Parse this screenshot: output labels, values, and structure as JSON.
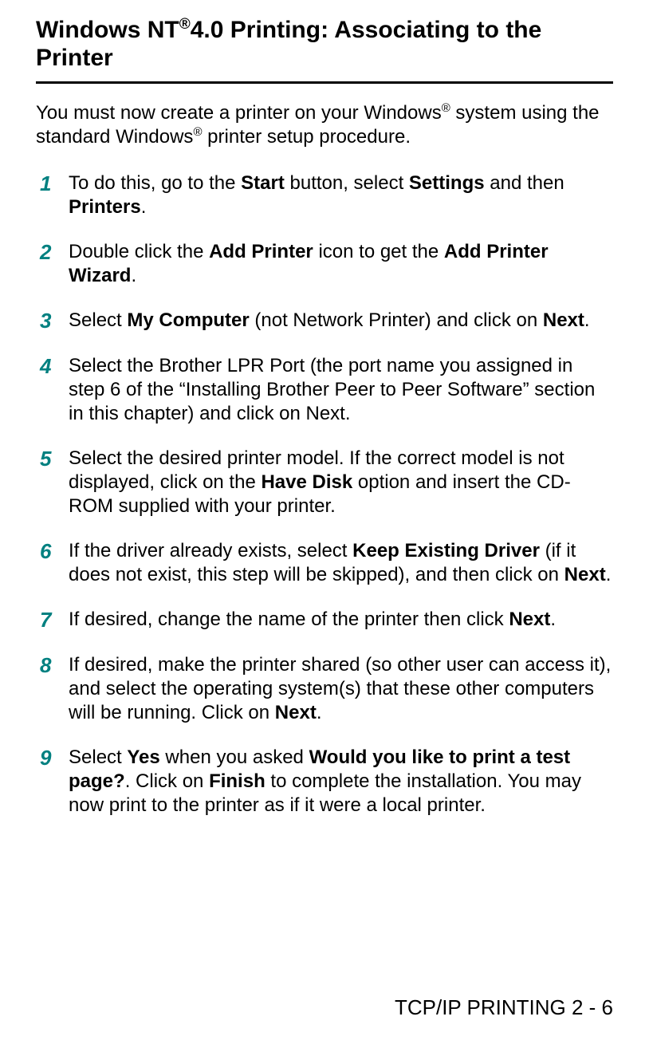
{
  "heading": {
    "pre": "Windows NT",
    "sup": "®",
    "post": "4.0 Printing: Associating to the Printer"
  },
  "intro": {
    "p1": "You must now create a printer on your Windows",
    "sup1": "®",
    "p2": " system using the standard Windows",
    "sup2": "®",
    "p3": " printer setup procedure."
  },
  "steps": [
    {
      "num": "1",
      "parts": [
        {
          "b": false,
          "t": "To do this, go to the "
        },
        {
          "b": true,
          "t": "Start"
        },
        {
          "b": false,
          "t": " button, select "
        },
        {
          "b": true,
          "t": "Settings"
        },
        {
          "b": false,
          "t": " and then "
        },
        {
          "b": true,
          "t": "Printers"
        },
        {
          "b": false,
          "t": "."
        }
      ]
    },
    {
      "num": "2",
      "parts": [
        {
          "b": false,
          "t": "Double click the "
        },
        {
          "b": true,
          "t": "Add Printer"
        },
        {
          "b": false,
          "t": " icon to get the "
        },
        {
          "b": true,
          "t": "Add Printer Wizard"
        },
        {
          "b": false,
          "t": "."
        }
      ]
    },
    {
      "num": "3",
      "parts": [
        {
          "b": false,
          "t": "Select "
        },
        {
          "b": true,
          "t": "My Computer"
        },
        {
          "b": false,
          "t": " (not Network Printer) and click on "
        },
        {
          "b": true,
          "t": "Next"
        },
        {
          "b": false,
          "t": "."
        }
      ]
    },
    {
      "num": "4",
      "parts": [
        {
          "b": false,
          "t": "Select the Brother LPR Port (the port name you assigned in step 6 of the “Installing Brother Peer to Peer Software” section in this chapter) and click on Next."
        }
      ]
    },
    {
      "num": "5",
      "parts": [
        {
          "b": false,
          "t": "Select the desired printer model. If the correct model is not displayed, click on the "
        },
        {
          "b": true,
          "t": "Have Disk"
        },
        {
          "b": false,
          "t": " option and insert the CD-ROM supplied with your printer."
        }
      ]
    },
    {
      "num": "6",
      "parts": [
        {
          "b": false,
          "t": "If the driver already exists, select "
        },
        {
          "b": true,
          "t": "Keep Existing Driver"
        },
        {
          "b": false,
          "t": " (if it does not exist, this step will be skipped), and then click on "
        },
        {
          "b": true,
          "t": "Next"
        },
        {
          "b": false,
          "t": "."
        }
      ]
    },
    {
      "num": "7",
      "parts": [
        {
          "b": false,
          "t": "If desired, change the name of the printer then click "
        },
        {
          "b": true,
          "t": "Next"
        },
        {
          "b": false,
          "t": "."
        }
      ]
    },
    {
      "num": "8",
      "parts": [
        {
          "b": false,
          "t": "If desired, make the printer shared (so other user can access it), and select the operating system(s) that these other computers will be running. Click on "
        },
        {
          "b": true,
          "t": "Next"
        },
        {
          "b": false,
          "t": "."
        }
      ]
    },
    {
      "num": "9",
      "parts": [
        {
          "b": false,
          "t": "Select "
        },
        {
          "b": true,
          "t": "Yes"
        },
        {
          "b": false,
          "t": " when you asked "
        },
        {
          "b": true,
          "t": "Would you like to print a test page?"
        },
        {
          "b": false,
          "t": ". Click on "
        },
        {
          "b": true,
          "t": "Finish"
        },
        {
          "b": false,
          "t": " to complete the installation. You may now print to the printer as if it were a local printer."
        }
      ]
    }
  ],
  "footer": "TCP/IP PRINTING 2 - 6"
}
